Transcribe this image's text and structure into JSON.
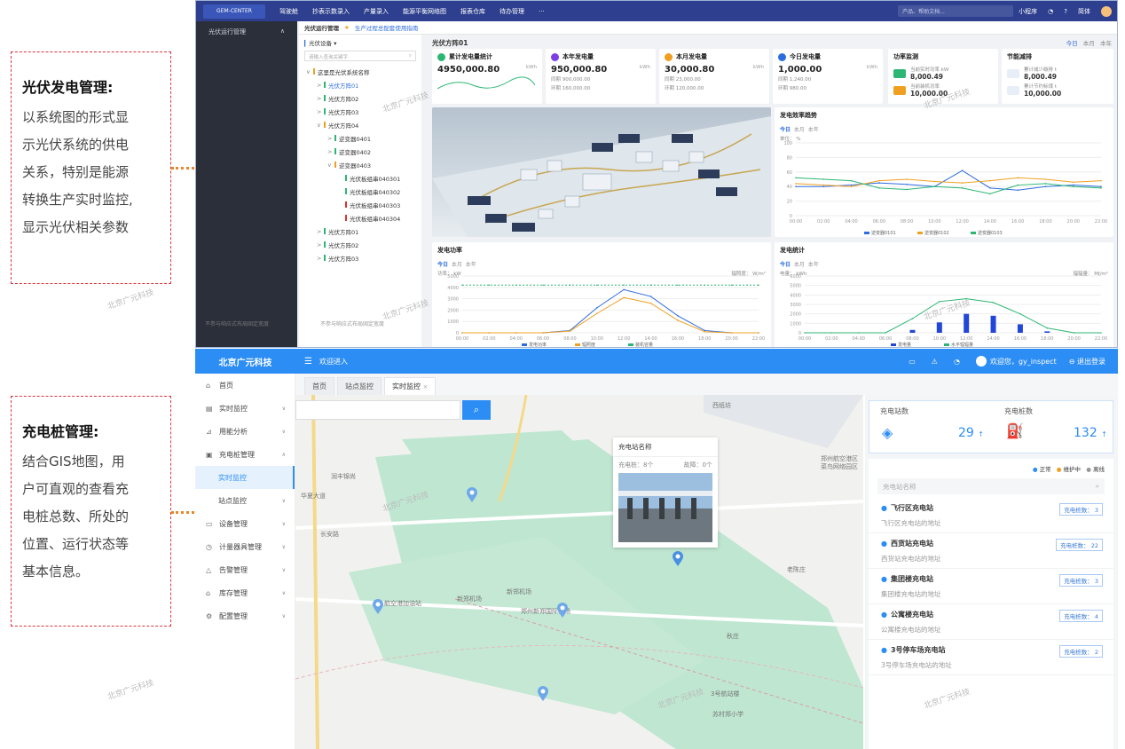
{
  "captions": {
    "pv": {
      "title": "光伏发电管理:",
      "lines": [
        "以系统图的形式显",
        "示光伏系统的供电",
        "关系，特别是能源",
        "转换生产实时监控,",
        "显示光伏相关参数"
      ]
    },
    "charge": {
      "title": "充电桩管理:",
      "lines": [
        "结合GIS地图，用",
        "户可直观的查看充",
        "电桩总数、所处的",
        "位置、运行状态等",
        "基本信息。"
      ]
    }
  },
  "watermark": "北京广元科技",
  "top_app": {
    "logo": "GEM-CENTER",
    "nav": [
      "驾驶舱",
      "抄表示数录入",
      "产量录入",
      "能源平衡网络图",
      "报表仓库",
      "待办管理",
      "···"
    ],
    "search_placeholder": "产品、帮助文档...",
    "right": [
      "小程序",
      "简体"
    ],
    "side_item": "光伏运行管理",
    "side_footer": "不参与响应式布局固定宽度",
    "tree_footer": "不参与响应式布局固定宽度",
    "breadcrumb": {
      "current": "光伏运行管理",
      "link": "生产过程总配套使用指南"
    },
    "tree_select": "光伏设备",
    "tree_search": "请输入查询关键字",
    "tree": [
      {
        "label": "这里是光伏系统名称",
        "level": 0,
        "color": "#f0a020",
        "arrow": "∨"
      },
      {
        "label": "光伏方阵01",
        "level": 1,
        "color": "#2bb673",
        "arrow": ">",
        "active": true
      },
      {
        "label": "光伏方阵02",
        "level": 1,
        "color": "#2bb673",
        "arrow": ">"
      },
      {
        "label": "光伏方阵03",
        "level": 1,
        "color": "#2bb673",
        "arrow": ">"
      },
      {
        "label": "光伏方阵04",
        "level": 1,
        "color": "#f0a020",
        "arrow": "∨"
      },
      {
        "label": "逆变器0401",
        "level": 2,
        "color": "#2bb673",
        "arrow": ">"
      },
      {
        "label": "逆变器0402",
        "level": 2,
        "color": "#2bb673",
        "arrow": ">"
      },
      {
        "label": "逆变器0403",
        "level": 2,
        "color": "#f0a020",
        "arrow": "∨"
      },
      {
        "label": "光伏板组串040301",
        "level": 3,
        "color": "#2bb673",
        "arrow": ""
      },
      {
        "label": "光伏板组串040302",
        "level": 3,
        "color": "#2bb673",
        "arrow": ""
      },
      {
        "label": "光伏板组串040303",
        "level": 3,
        "color": "#e03030",
        "arrow": ""
      },
      {
        "label": "光伏板组串040304",
        "level": 3,
        "color": "#e03030",
        "arrow": ""
      },
      {
        "label": "光伏方阵01",
        "level": 1,
        "color": "#2bb673",
        "arrow": ">"
      },
      {
        "label": "光伏方阵02",
        "level": 1,
        "color": "#2bb673",
        "arrow": ">"
      },
      {
        "label": "光伏方阵03",
        "level": 1,
        "color": "#2bb673",
        "arrow": ">"
      }
    ],
    "main_title": "光伏方阵01",
    "period_tabs": [
      "今日",
      "本月",
      "本年"
    ],
    "stats": [
      {
        "title": "累计发电量统计",
        "value": "4950,000.80",
        "unit": "kWh",
        "color": "#2bb673"
      },
      {
        "title": "本年发电量",
        "value": "950,000.80",
        "unit": "kWh",
        "sub1": "同期 900,000.00",
        "sub2": "环期 160,000.00",
        "color": "#7b3fe4"
      },
      {
        "title": "本月发电量",
        "value": "30,000.80",
        "unit": "kWh",
        "sub1": "同期 23,000.00",
        "sub2": "环期 120,000.00",
        "color": "#f0a020"
      },
      {
        "title": "今日发电量",
        "value": "1,000.00",
        "unit": "kWh",
        "sub1": "同期 1,240.00",
        "sub2": "环期 980.00",
        "color": "#2d6cdf"
      }
    ],
    "power_monitor": {
      "title": "功率监测",
      "a_label": "当前实时功率 kW",
      "a_value": "8,000.49",
      "b_label": "当前装机功率",
      "b_value": "10,000.00"
    },
    "energy_saving": {
      "title": "节能减排",
      "a_label": "累计减少碳排 t",
      "a_value": "8,000.49",
      "b_label": "累计节约标煤 t",
      "b_value": "10,000.00"
    },
    "efficiency": {
      "title": "发电效率趋势",
      "unit": "单位： %",
      "legend": [
        "逆变器0101",
        "逆变器0102",
        "逆变器0103"
      ]
    },
    "power_chart": {
      "title": "发电功率",
      "left_unit": "功率： kW",
      "right_unit": "辐照度： W/m²",
      "legend": [
        "发电功率",
        "辐照度",
        "装机容量"
      ]
    },
    "gen_chart": {
      "title": "发电统计",
      "left_unit": "电量： kWh",
      "right_unit": "辐辐量： MJ/m²",
      "legend": [
        "发电量",
        "水平辐辐量"
      ]
    }
  },
  "chart_data": [
    {
      "type": "line",
      "title": "发电效率趋势",
      "ylabel": "%",
      "ylim": [
        0,
        100
      ],
      "yticks": [
        0,
        20,
        40,
        60,
        80,
        100
      ],
      "x": [
        "00:00",
        "02:00",
        "04:00",
        "06:00",
        "08:00",
        "10:00",
        "12:00",
        "14:00",
        "16:00",
        "18:00",
        "20:00",
        "22:00"
      ],
      "series": [
        {
          "name": "逆变器0101",
          "values": [
            40,
            40,
            42,
            45,
            43,
            40,
            62,
            38,
            35,
            40,
            42,
            40
          ]
        },
        {
          "name": "逆变器0102",
          "values": [
            44,
            42,
            40,
            48,
            50,
            47,
            45,
            48,
            52,
            50,
            46,
            48
          ]
        },
        {
          "name": "逆变器0103",
          "values": [
            52,
            50,
            48,
            38,
            36,
            40,
            38,
            30,
            42,
            44,
            40,
            38
          ]
        }
      ]
    },
    {
      "type": "line",
      "title": "发电功率",
      "ylabel": "kW",
      "ylim": [
        0,
        5000
      ],
      "yticks": [
        0,
        1000,
        2000,
        3000,
        4000,
        5000
      ],
      "x": [
        "00:00",
        "02:00",
        "04:00",
        "06:00",
        "08:00",
        "10:00",
        "12:00",
        "14:00",
        "16:00",
        "18:00",
        "20:00",
        "22:00"
      ],
      "series": [
        {
          "name": "发电功率",
          "values": [
            0,
            0,
            0,
            0,
            200,
            2200,
            3800,
            3200,
            1500,
            200,
            0,
            0
          ]
        },
        {
          "name": "辐照度",
          "values": [
            0,
            0,
            0,
            0,
            150,
            1700,
            3100,
            2600,
            1100,
            100,
            0,
            0
          ]
        },
        {
          "name": "装机容量",
          "values": [
            4200,
            4200,
            4200,
            4200,
            4200,
            4200,
            4200,
            4200,
            4200,
            4200,
            4200,
            4200
          ]
        }
      ]
    },
    {
      "type": "bar",
      "title": "发电统计",
      "ylabel": "kWh",
      "ylim": [
        0,
        6000
      ],
      "yticks": [
        0,
        1000,
        2000,
        3000,
        4000,
        5000,
        6000
      ],
      "categories": [
        "00:00",
        "02:00",
        "04:00",
        "06:00",
        "08:00",
        "10:00",
        "12:00",
        "14:00",
        "16:00",
        "18:00",
        "20:00",
        "22:00"
      ],
      "series": [
        {
          "name": "发电量",
          "values": [
            0,
            0,
            0,
            0,
            300,
            1100,
            2000,
            1800,
            900,
            150,
            0,
            0
          ]
        },
        {
          "name": "水平辐辐量",
          "values": [
            0,
            0,
            0,
            0,
            1500,
            3300,
            3600,
            3200,
            2000,
            500,
            0,
            0
          ]
        }
      ]
    }
  ],
  "bottom_app": {
    "brand": "北京广元科技",
    "header_menu": "欢迎进入",
    "user": "欢迎您，gy_inspect",
    "logout": "退出登录",
    "menu": [
      {
        "label": "首页",
        "icon": "⌂",
        "chev": ""
      },
      {
        "label": "实时监控",
        "icon": "▤",
        "chev": "∨"
      },
      {
        "label": "用能分析",
        "icon": "⊿",
        "chev": "∨"
      },
      {
        "label": "充电桩管理",
        "icon": "▣",
        "chev": "∧",
        "open": true
      },
      {
        "label": "实时监控",
        "sub": true,
        "active": true
      },
      {
        "label": "站点监控",
        "sub": true,
        "chev": "∨"
      },
      {
        "label": "设备管理",
        "icon": "▭",
        "chev": "∨"
      },
      {
        "label": "计量器具管理",
        "icon": "◷",
        "chev": "∨"
      },
      {
        "label": "告警管理",
        "icon": "△",
        "chev": "∨"
      },
      {
        "label": "库存管理",
        "icon": "⌂",
        "chev": "∨"
      },
      {
        "label": "配置管理",
        "icon": "⚙",
        "chev": "∨"
      }
    ],
    "tabs": [
      "首页",
      "站点监控",
      "实时监控"
    ],
    "map": {
      "labels": [
        "西纸坊",
        "润丰锦尚",
        "华夏大道",
        "长安路",
        "郑州航空港区菜鸟网络园区",
        "老陈庄",
        "新郑机场",
        "新郑机场",
        "郑州新郑国际机场",
        "航空港加油站",
        "秋庄",
        "3号航站楼",
        "苏村郑小学"
      ],
      "popup": {
        "title": "充电站名称",
        "piles": "充电桩：8个",
        "faults": "故障：0个"
      }
    },
    "totals": {
      "stations_label": "充电站数",
      "stations": "29",
      "piles_label": "充电桩数",
      "piles": "132"
    },
    "legend": [
      "正常",
      "维护中",
      "离线"
    ],
    "station_search": "充电站名称",
    "stations": [
      {
        "name": "飞行区充电站",
        "addr": "飞行区充电站的地址",
        "badge": "充电桩数： 3"
      },
      {
        "name": "西货站充电站",
        "addr": "西货站充电站的地址",
        "badge": "充电桩数： 22"
      },
      {
        "name": "集团楼充电站",
        "addr": "集团楼充电站的地址",
        "badge": "充电桩数： 3"
      },
      {
        "name": "公寓楼充电站",
        "addr": "公寓楼充电站的地址",
        "badge": "充电桩数： 4"
      },
      {
        "name": "3号停车场充电站",
        "addr": "3号停车场充电站的地址",
        "badge": "充电桩数： 2"
      }
    ]
  },
  "colors": {
    "accent": "#2c8df4",
    "nav": "#2d3f8e",
    "caption_border": "#d9363e",
    "connector": "#e8862a"
  }
}
